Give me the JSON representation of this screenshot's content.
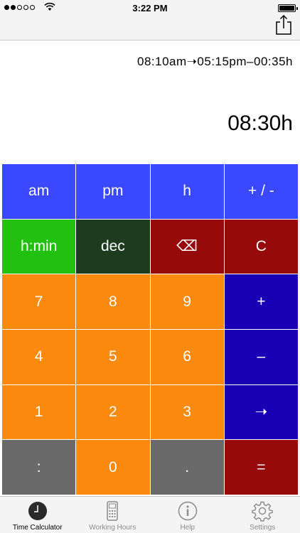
{
  "status_bar": {
    "time": "3:22 PM",
    "signal_dots_filled": 2,
    "signal_dots_total": 5,
    "battery_level": 1.0,
    "icons": [
      "signal-dots-icon",
      "wifi-icon",
      "battery-icon"
    ]
  },
  "nav": {
    "share_icon": "share-icon"
  },
  "display": {
    "expression": "08:10am➝05:15pm–00:35h",
    "result": "08:30h"
  },
  "keypad": {
    "keys": [
      {
        "label": "am",
        "color": "#3a48ff",
        "name": "key-am"
      },
      {
        "label": "pm",
        "color": "#3a48ff",
        "name": "key-pm"
      },
      {
        "label": "h",
        "color": "#3a48ff",
        "name": "key-h"
      },
      {
        "label": "+ / -",
        "color": "#3a48ff",
        "name": "key-plus-minus"
      },
      {
        "label": "h:min",
        "color": "#22c00f",
        "name": "key-h-min"
      },
      {
        "label": "dec",
        "color": "#1d3c1f",
        "name": "key-dec"
      },
      {
        "label": "⌫",
        "color": "#960a0a",
        "name": "key-backspace"
      },
      {
        "label": "C",
        "color": "#960a0a",
        "name": "key-clear"
      },
      {
        "label": "7",
        "color": "#fb8a0e",
        "name": "key-7"
      },
      {
        "label": "8",
        "color": "#fb8a0e",
        "name": "key-8"
      },
      {
        "label": "9",
        "color": "#fb8a0e",
        "name": "key-9"
      },
      {
        "label": "+",
        "color": "#1a00b5",
        "name": "key-add"
      },
      {
        "label": "4",
        "color": "#fb8a0e",
        "name": "key-4"
      },
      {
        "label": "5",
        "color": "#fb8a0e",
        "name": "key-5"
      },
      {
        "label": "6",
        "color": "#fb8a0e",
        "name": "key-6"
      },
      {
        "label": "–",
        "color": "#1a00b5",
        "name": "key-subtract"
      },
      {
        "label": "1",
        "color": "#fb8a0e",
        "name": "key-1"
      },
      {
        "label": "2",
        "color": "#fb8a0e",
        "name": "key-2"
      },
      {
        "label": "3",
        "color": "#fb8a0e",
        "name": "key-3"
      },
      {
        "label": "➝",
        "color": "#1a00b5",
        "name": "key-arrow"
      },
      {
        "label": ":",
        "color": "#6a6a6a",
        "name": "key-colon"
      },
      {
        "label": "0",
        "color": "#fb8a0e",
        "name": "key-0"
      },
      {
        "label": ".",
        "color": "#6a6a6a",
        "name": "key-dot"
      },
      {
        "label": "=",
        "color": "#960a0a",
        "name": "key-equals"
      }
    ]
  },
  "tabbar": {
    "tabs": [
      {
        "label": "Time Calculator",
        "icon": "clock-icon",
        "active": true
      },
      {
        "label": "Working Hours",
        "icon": "calculator-icon",
        "active": false
      },
      {
        "label": "Help",
        "icon": "info-icon",
        "active": false
      },
      {
        "label": "Settings",
        "icon": "gear-icon",
        "active": false
      }
    ]
  }
}
